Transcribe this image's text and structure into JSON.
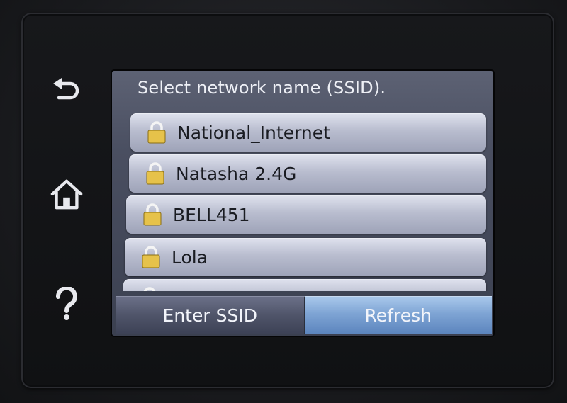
{
  "screen": {
    "title": "Select network name (SSID).",
    "networks": [
      {
        "name": "National_Internet",
        "secured": true
      },
      {
        "name": "Natasha 2.4G",
        "secured": true
      },
      {
        "name": "BELL451",
        "secured": true
      },
      {
        "name": "Lola",
        "secured": true
      },
      {
        "name": "",
        "secured": true
      }
    ],
    "buttons": {
      "enter_ssid": "Enter SSID",
      "refresh": "Refresh"
    }
  },
  "side_panel": {
    "icons": [
      "back-arrow-icon",
      "home-icon",
      "help-question-icon"
    ]
  },
  "colors": {
    "refresh_button": "#7ea4d4",
    "lock_gold": "#e6c24a",
    "list_row": "#c4c8d8"
  }
}
